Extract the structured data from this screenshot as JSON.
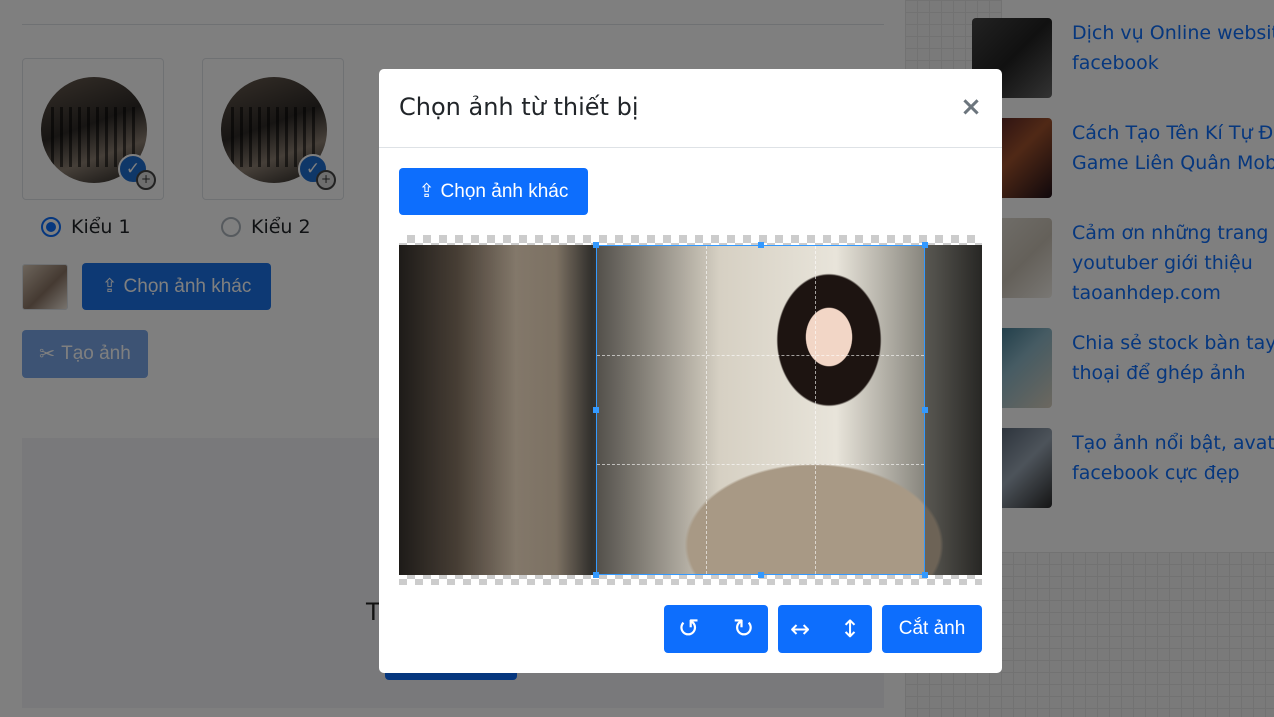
{
  "background": {
    "style_options": [
      {
        "label": "Kiểu 1",
        "checked": true
      },
      {
        "label": "Kiểu 2",
        "checked": false
      }
    ],
    "upload_button_label": "Chọn ảnh khác",
    "create_button_label": "Tạo ảnh",
    "preview_text": "T"
  },
  "sidebar": {
    "items": [
      {
        "lines": [
          "Dịch vụ Online website",
          "facebook"
        ],
        "thumb_text": "Dịch vụ Onlin"
      },
      {
        "lines": [
          "Cách Tạo Tên Kí Tự Đặc",
          "Game Liên Quân Mobil"
        ]
      },
      {
        "lines": [
          "Cảm ơn những trang w",
          "youtuber giới thiệu",
          "taoanhdep.com"
        ]
      },
      {
        "lines": [
          "Chia sẻ stock bàn tay c",
          "thoại để ghép ảnh"
        ]
      },
      {
        "lines": [
          "Tạo ảnh nổi bật, avatar",
          "facebook cực đẹp"
        ]
      }
    ]
  },
  "modal": {
    "title": "Chọn ảnh từ thiết bị",
    "close_glyph": "×",
    "upload_button_label": "Chọn ảnh khác",
    "rotate_left_glyph": "↺",
    "rotate_right_glyph": "↻",
    "flip_horizontal_glyph": "↔",
    "flip_vertical_glyph": "↕",
    "crop_button_label": "Cắt ảnh",
    "upload_icon_glyph": "⇪"
  },
  "colors": {
    "primary": "#0d6efd",
    "crop_border": "#3399ff"
  }
}
